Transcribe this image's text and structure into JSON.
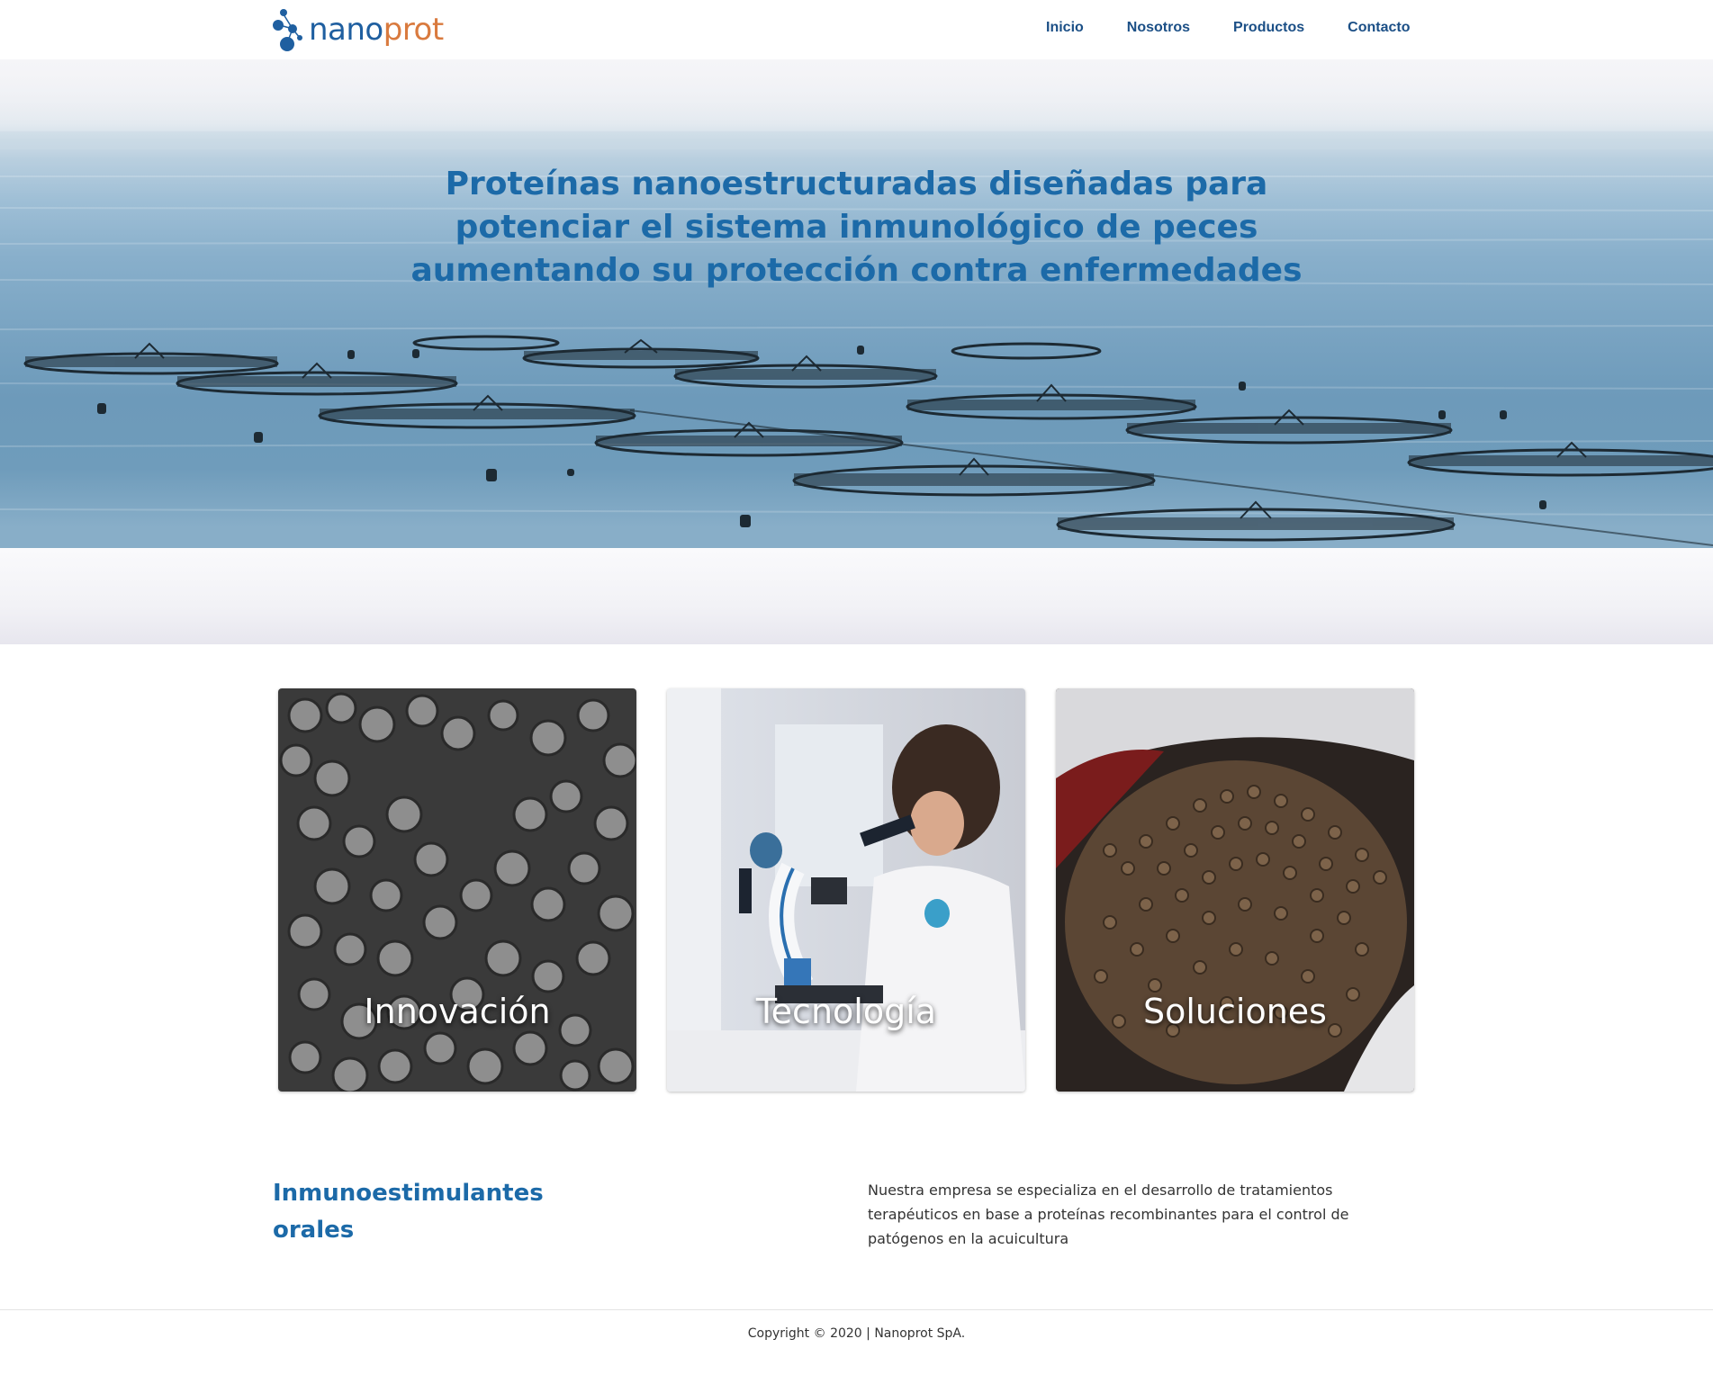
{
  "brand": {
    "name_part1": "nano",
    "name_part2": "prot",
    "primary_color": "#1f5fa0",
    "accent_color": "#d97a3e"
  },
  "nav": {
    "items": [
      "Inicio",
      "Nosotros",
      "Productos",
      "Contacto"
    ]
  },
  "hero": {
    "title": "Proteínas nanoestructuradas diseñadas para potenciar el sistema inmunológico de peces aumentando su protección contra enfermedades",
    "background_image": "fish-farm-sea-cages"
  },
  "cards": [
    {
      "title": "Innovación",
      "image": "microscopy-particles-image"
    },
    {
      "title": "Tecnología",
      "image": "lab-scientist-microscope-image"
    },
    {
      "title": "Soluciones",
      "image": "fish-feed-pellets-image"
    }
  ],
  "info": {
    "heading": "Inmunoestimulantes orales",
    "text": "Nuestra empresa se especializa en el desarrollo de tratamientos terapéuticos en base a proteínas recombinantes para el control de patógenos en la acuicultura"
  },
  "footer": {
    "copyright": "Copyright © 2020 | Nanoprot SpA."
  }
}
